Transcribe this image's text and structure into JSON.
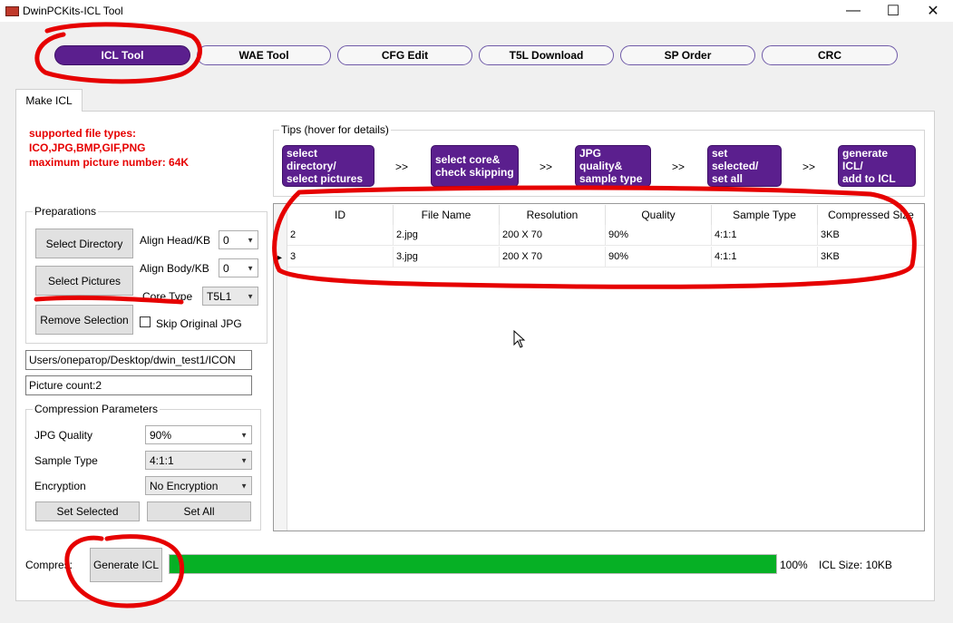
{
  "window": {
    "title": "DwinPCKits-ICL Tool",
    "minimize": "—",
    "maximize": "☐",
    "close": "✕"
  },
  "top_tabs": [
    "ICL Tool",
    "WAE Tool",
    "CFG Edit",
    "T5L Download",
    "SP Order",
    "CRC"
  ],
  "active_tab": "ICL Tool",
  "panel_tab": "Make ICL",
  "info": {
    "line1": "supported file types:",
    "line2": "ICO,JPG,BMP,GIF,PNG",
    "line3": "maximum picture number: 64K"
  },
  "preparations": {
    "legend": "Preparations",
    "select_directory": "Select Directory",
    "select_pictures": "Select Pictures",
    "remove_selection": "Remove Selection",
    "align_head_label": "Align Head/KB",
    "align_head_value": "0",
    "align_body_label": "Align Body/KB",
    "align_body_value": "0",
    "core_type_label": "Core Type",
    "core_type_value": "T5L1",
    "skip_jpg_label": "Skip Original JPG"
  },
  "path_value": "Users/оператор/Desktop/dwin_test1/ICON",
  "picture_count": "Picture count:2",
  "compression": {
    "legend": "Compression Parameters",
    "jpg_quality_label": "JPG Quality",
    "jpg_quality_value": "90%",
    "sample_type_label": "Sample Type",
    "sample_type_value": "4:1:1",
    "encryption_label": "Encryption",
    "encryption_value": "No Encryption",
    "set_selected": "Set Selected",
    "set_all": "Set All"
  },
  "tips": {
    "legend": "Tips (hover for details)",
    "steps": [
      [
        "select directory/",
        "select pictures"
      ],
      [
        "select core&",
        "check skipping"
      ],
      [
        "JPG quality&",
        "sample type"
      ],
      [
        "set selected/",
        "set all"
      ],
      [
        "generate ICL/",
        "add to ICL"
      ]
    ],
    "arrow": ">>"
  },
  "table": {
    "columns": [
      "ID",
      "File Name",
      "Resolution",
      "Quality",
      "Sample Type",
      "Compressed Size"
    ],
    "rows": [
      [
        "2",
        "2.jpg",
        "200 X 70",
        "90%",
        "4:1:1",
        "3KB"
      ],
      [
        "3",
        "3.jpg",
        "200 X 70",
        "90%",
        "4:1:1",
        "3KB"
      ]
    ]
  },
  "bottom": {
    "compress_label": "Compres:",
    "generate_button": "Generate ICL",
    "progress_percent": 100,
    "progress_text": "100%",
    "icl_size": "ICL Size:  10KB"
  },
  "colors": {
    "accent": "#5b1f8e",
    "progress": "#06b025",
    "annotation": "#e60000"
  }
}
